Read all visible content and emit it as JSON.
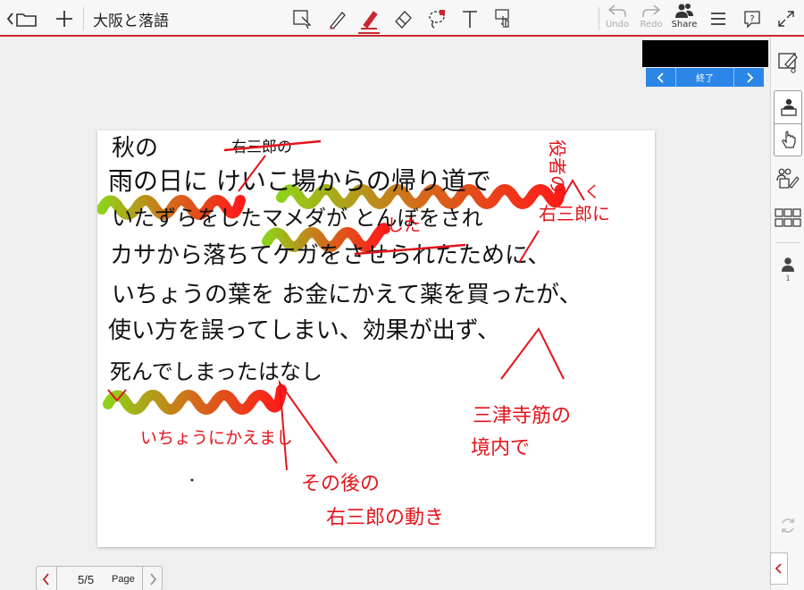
{
  "app": {
    "title": "大阪と落語",
    "accent_color": "#c8282d"
  },
  "toolbar": {
    "left_buttons": [
      "back-folder-icon",
      "add-icon"
    ],
    "tools": [
      "select-icon",
      "pen-icon",
      "highlighter-icon",
      "eraser-icon",
      "lasso-icon",
      "text-icon",
      "pointer-icon"
    ],
    "active_tool": "highlighter-icon",
    "undo_label": "Undo",
    "redo_label": "Redo",
    "share_label": "Share"
  },
  "presenter": {
    "end_label": "終了",
    "nav_color": "#2b86e8"
  },
  "sidebar": {
    "participant_count": "1"
  },
  "pager": {
    "page_indicator": "5/5",
    "page_label": "Page"
  },
  "slide": {
    "lines": [
      "秋の",
      "雨の日に けいこ場からの帰り道で",
      "いたずらをしたマメダが とんぼをされ",
      "カサから落ちてケガをさせられたために、",
      "いちょうの葉を お金にかえて薬を買ったが、",
      "使い方を誤ってしまい、効果が出ず、",
      "死んでしまったはなし"
    ],
    "annotations": {
      "insert_name": "右三郎の",
      "role_note_1": "役者の",
      "role_note_2": "右三郎に",
      "role_note_3": "く",
      "shita": "した",
      "place_1": "三津寺筋の",
      "place_2": "境内で",
      "ginkgo": "いちょうにかえまし",
      "after_1": "その後の",
      "after_2": "右三郎の動き"
    }
  }
}
